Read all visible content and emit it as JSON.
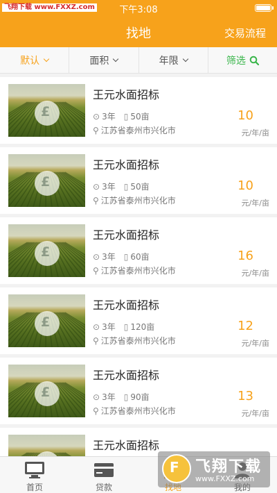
{
  "status": {
    "watermark": "飞翔下载 www.FXXZ.com",
    "time": "下午3:08"
  },
  "nav": {
    "title": "找地",
    "right": "交易流程"
  },
  "filters": [
    {
      "label": "默认",
      "state": "active"
    },
    {
      "label": "面积",
      "state": "normal"
    },
    {
      "label": "年限",
      "state": "normal"
    },
    {
      "label": "筛选",
      "state": "screen",
      "icon": "search-icon"
    }
  ],
  "listings": [
    {
      "title": "王元水面招标",
      "years": "3年",
      "area": "50亩",
      "location": "江苏省泰州市兴化市",
      "price": "10",
      "unit": "元/年/亩"
    },
    {
      "title": "王元水面招标",
      "years": "3年",
      "area": "50亩",
      "location": "江苏省泰州市兴化市",
      "price": "10",
      "unit": "元/年/亩"
    },
    {
      "title": "王元水面招标",
      "years": "3年",
      "area": "60亩",
      "location": "江苏省泰州市兴化市",
      "price": "16",
      "unit": "元/年/亩"
    },
    {
      "title": "王元水面招标",
      "years": "3年",
      "area": "120亩",
      "location": "江苏省泰州市兴化市",
      "price": "12",
      "unit": "元/年/亩"
    },
    {
      "title": "王元水面招标",
      "years": "3年",
      "area": "90亩",
      "location": "江苏省泰州市兴化市",
      "price": "13",
      "unit": "元/年/亩"
    },
    {
      "title": "王元水面招标",
      "years": "",
      "area": "",
      "location": "",
      "price": "",
      "unit": ""
    }
  ],
  "tabs": [
    {
      "label": "首页",
      "icon": "monitor-icon",
      "active": false
    },
    {
      "label": "贷款",
      "icon": "card-icon",
      "active": false
    },
    {
      "label": "找地",
      "icon": "map-icon",
      "active": true
    },
    {
      "label": "我的",
      "icon": "person-icon",
      "active": false
    }
  ],
  "watermark": {
    "name": "飞翔下载",
    "url": "www.FXXZ.com"
  },
  "colors": {
    "accent": "#f7a21b",
    "filter_green": "#39b54a",
    "header": "#f7a21b"
  }
}
